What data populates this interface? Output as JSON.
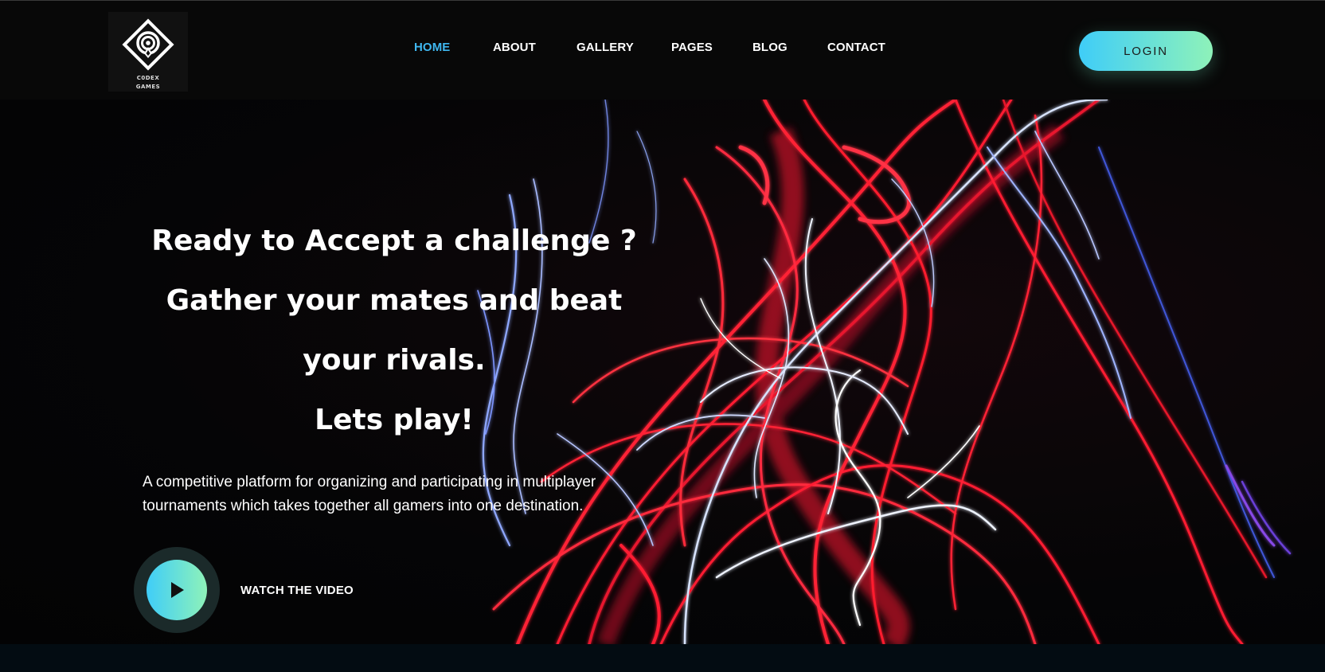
{
  "brand": {
    "logo_line1": "C0DEX",
    "logo_line2": "GAMES"
  },
  "nav": {
    "items": [
      {
        "label": "HOME",
        "active": true
      },
      {
        "label": "ABOUT",
        "active": false
      },
      {
        "label": "GALLERY",
        "active": false
      },
      {
        "label": "PAGES",
        "active": false
      },
      {
        "label": "BLOG",
        "active": false
      },
      {
        "label": "CONTACT",
        "active": false
      }
    ],
    "login_label": "LOGIN"
  },
  "hero": {
    "headline": {
      "line1": "Ready to Accept a challenge ?",
      "line2": "Gather your mates and beat",
      "line3": "your rivals.",
      "line4": "Lets play!"
    },
    "description": "A competitive platform for organizing and participating in multiplayer tournaments which takes together all gamers into one destination.",
    "watch_label": "WATCH THE VIDEO"
  },
  "colors": {
    "accent_active_nav": "#3fb7f0",
    "gradient_start": "#3fcdf8",
    "gradient_end": "#8ef2b9",
    "background": "#060606"
  },
  "icons": {
    "logo": "diamond-target-logo-icon",
    "play": "play-icon"
  }
}
